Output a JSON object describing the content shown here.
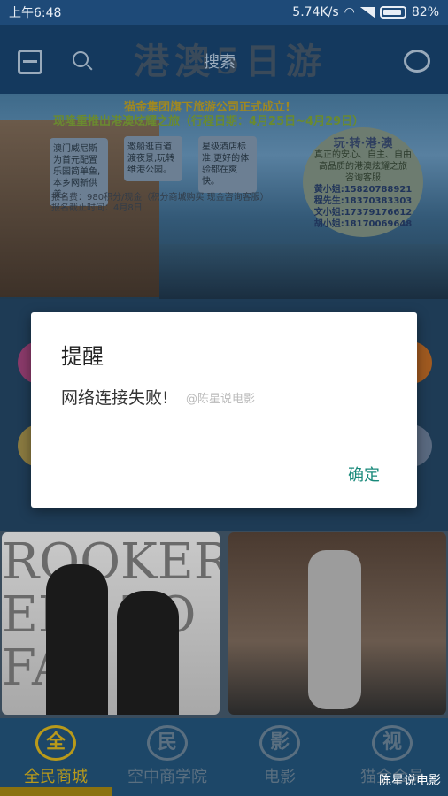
{
  "status_bar": {
    "time": "上午6:48",
    "speed": "5.74K/s",
    "battery": "82%"
  },
  "header": {
    "title": "港澳5日游",
    "search_text": "搜索"
  },
  "banner": {
    "line1": "猫金集团旗下旅游公司正式成立!",
    "line2": "现隆重推出港澳炫耀之旅（行程日期：4月25日~4月29日）",
    "note1": "澳门威尼斯为首元配置乐园简单鱼,本乡网新供美。",
    "note2": "邀船逛百道渡夜景,玩转维港公园。",
    "note3": "星级酒店标准,更好的体验都在爽快。",
    "fee_line": "报名费：980积分/现金（积分商城购买 现金咨询客服）",
    "deadline_line": "报名截止时间：4月8日",
    "contact": {
      "title": "玩·转·港·澳",
      "desc1": "真正的安心、自主、自由",
      "desc2": "高品质的港澳炫耀之旅",
      "desc3": "咨询客服",
      "phones": [
        "黄小姐:15820788921",
        "程先生:18370383303",
        "文小姐:17379176612",
        "胡小姐:18170069648"
      ]
    }
  },
  "dialog": {
    "title": "提醒",
    "message": "网络连接失败!",
    "ok_label": "确定"
  },
  "watermark": {
    "mid": "@陈星说电影",
    "bottom": "陈星说电影"
  },
  "products": {
    "card1_bg_text": "ROOKER\nERY TO\nFAB"
  },
  "bottom_nav": {
    "items": [
      {
        "badge": "全",
        "label": "全民商城"
      },
      {
        "badge": "民",
        "label": "空中商学院"
      },
      {
        "badge": "影",
        "label": "电影"
      },
      {
        "badge": "视",
        "label": "猫金会员"
      }
    ]
  },
  "colors": {
    "accent": "#b99a1a",
    "dialog_button": "#18897a"
  }
}
